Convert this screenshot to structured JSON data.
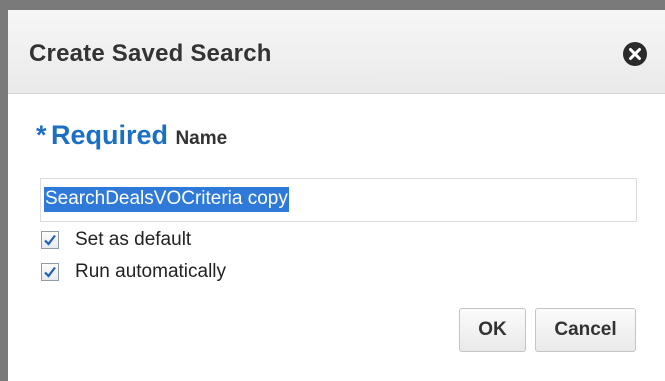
{
  "dialog": {
    "title": "Create Saved Search",
    "close_icon": "close-circle-icon"
  },
  "form": {
    "required_star": "*",
    "required_label": "Required",
    "name_label": "Name",
    "name_value": "SearchDealsVOCriteria copy",
    "checkboxes": [
      {
        "label": "Set as default",
        "checked": true
      },
      {
        "label": "Run automatically",
        "checked": true
      }
    ]
  },
  "buttons": {
    "ok_label": "OK",
    "cancel_label": "Cancel"
  },
  "colors": {
    "required_blue": "#1b70c4",
    "selection_blue": "#2f7ad8"
  }
}
